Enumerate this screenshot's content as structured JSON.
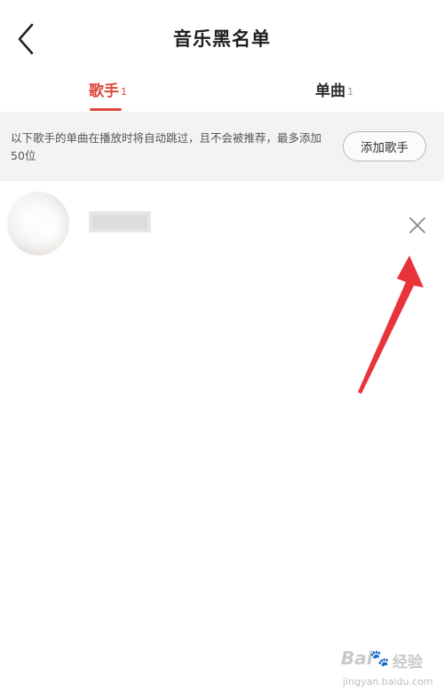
{
  "header": {
    "title": "音乐黑名单"
  },
  "tabs": [
    {
      "label": "歌手",
      "count": "1",
      "active": true
    },
    {
      "label": "单曲",
      "count": "1",
      "active": false
    }
  ],
  "notice": {
    "text": "以下歌手的单曲在播放时将自动跳过，且不会被推荐，最多添加50位",
    "add_button_label": "添加歌手"
  },
  "colors": {
    "accent": "#dd4a3c",
    "arrow": "#e8333a",
    "notice_bg": "#f3f3f3"
  },
  "watermark": {
    "brand": "Bai",
    "brand_suffix": "经验",
    "url": "jingyan.baidu.com"
  }
}
